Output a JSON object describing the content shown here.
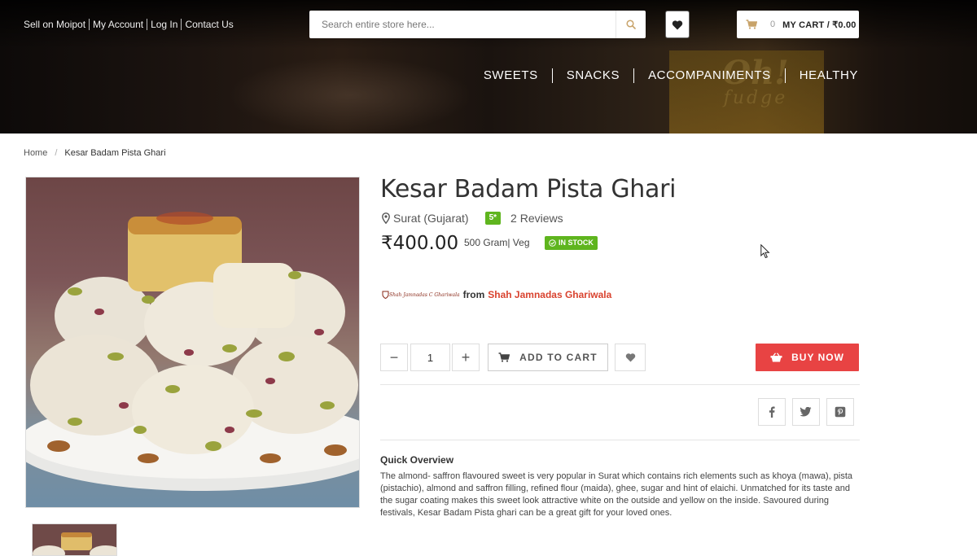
{
  "header": {
    "top_links": [
      "Sell on Moipot",
      "My Account",
      "Log In",
      "Contact Us"
    ],
    "search": {
      "placeholder": "Search entire store here..."
    },
    "cart": {
      "count": "0",
      "label": "MY CART / ₹0.00"
    },
    "nav": [
      "SWEETS",
      "SNACKS",
      "ACCOMPANIMENTS",
      "HEALTHY"
    ],
    "banner_text": [
      "Oh!",
      "fudge"
    ]
  },
  "breadcrumb": {
    "home": "Home",
    "separator": "/",
    "current": "Kesar Badam Pista Ghari"
  },
  "product": {
    "title": "Kesar Badam Pista Ghari",
    "location": "Surat (Gujarat)",
    "rating": "5*",
    "reviews": "2 Reviews",
    "price": "₹400.00",
    "weight": "500 Gram| Veg",
    "stock": "IN STOCK",
    "seller_logo_text": "Shah Jamnadas C Ghariwala",
    "seller_from": "from",
    "seller_name": "Shah Jamnadas Ghariwala",
    "quantity": "1",
    "minus_label": "−",
    "plus_label": "+",
    "add_to_cart": "ADD TO CART",
    "buy_now": "BUY NOW",
    "overview_title": "Quick Overview",
    "overview_text": "The almond- saffron flavoured sweet is very popular in Surat which contains rich elements such as khoya (mawa), pista (pistachio), almond and saffron filling, refined flour (maida), ghee, sugar and hint of elaichi. Unmatched for its taste and the sugar coating makes this sweet look attractive white on the outside and yellow on the inside. Savoured during festivals, Kesar Badam Pista ghari can be a great gift for your loved ones."
  },
  "icons": {
    "search": "search-icon",
    "wishlist": "heart-icon",
    "cart": "cart-icon",
    "location": "map-pin-icon",
    "stock": "check-circle-icon",
    "facebook": "facebook-icon",
    "twitter": "twitter-icon",
    "pinterest": "pinterest-icon",
    "buy": "basket-icon"
  },
  "colors": {
    "accent_red": "#e84343",
    "seller_red": "#d9432f",
    "badge_green": "#5fb51e",
    "search_icon_gold": "#c8a36a"
  }
}
